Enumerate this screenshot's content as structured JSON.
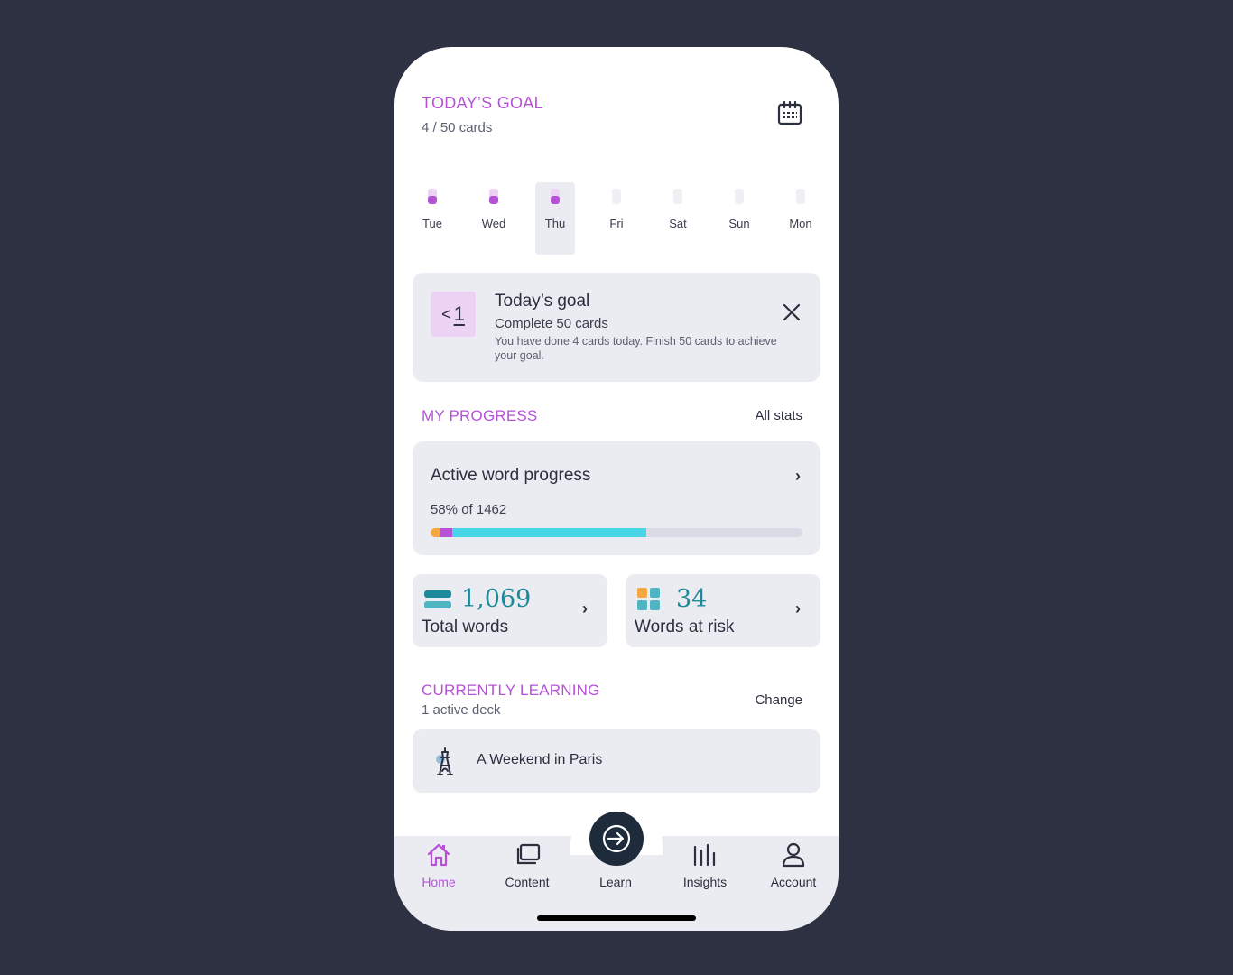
{
  "goal": {
    "title": "TODAY’S GOAL",
    "cards_text": "4 / 50 cards"
  },
  "week": [
    {
      "label": "Tue",
      "done": true,
      "selected": false
    },
    {
      "label": "Wed",
      "done": true,
      "selected": false
    },
    {
      "label": "Thu",
      "done": true,
      "selected": true
    },
    {
      "label": "Fri",
      "done": false,
      "selected": false
    },
    {
      "label": "Sat",
      "done": false,
      "selected": false
    },
    {
      "label": "Sun",
      "done": false,
      "selected": false
    },
    {
      "label": "Mon",
      "done": false,
      "selected": false
    }
  ],
  "goal_card": {
    "badge_lt": "<",
    "badge_num": "1",
    "title": "Today’s goal",
    "subtitle": "Complete 50 cards",
    "description": "You have done 4 cards today. Finish 50 cards to achieve your goal."
  },
  "progress": {
    "section_title": "MY PROGRESS",
    "all_stats": "All stats",
    "card_title": "Active word progress",
    "summary": "58% of 1462",
    "segments": [
      {
        "fraction": 0.024,
        "color": "#f5a742"
      },
      {
        "fraction": 0.034,
        "color": "#b552d6"
      },
      {
        "fraction": 0.523,
        "color": "#47d6e8"
      }
    ]
  },
  "stats": {
    "total_words": {
      "value": "1,069",
      "label": "Total words"
    },
    "words_at_risk": {
      "value": "34",
      "label": "Words at risk"
    }
  },
  "learning": {
    "section_title": "CURRENTLY LEARNING",
    "subtitle": "1 active deck",
    "change": "Change",
    "deck_name": "A Weekend in Paris"
  },
  "tabs": [
    {
      "id": "home",
      "label": "Home",
      "active": true
    },
    {
      "id": "content",
      "label": "Content",
      "active": false
    },
    {
      "id": "learn",
      "label": "Learn",
      "active": false
    },
    {
      "id": "insights",
      "label": "Insights",
      "active": false
    },
    {
      "id": "account",
      "label": "Account",
      "active": false
    }
  ],
  "colors": {
    "accent": "#b552d6",
    "teal": "#1c8a9a",
    "background": "#2d3142",
    "card": "#ebecf1"
  }
}
